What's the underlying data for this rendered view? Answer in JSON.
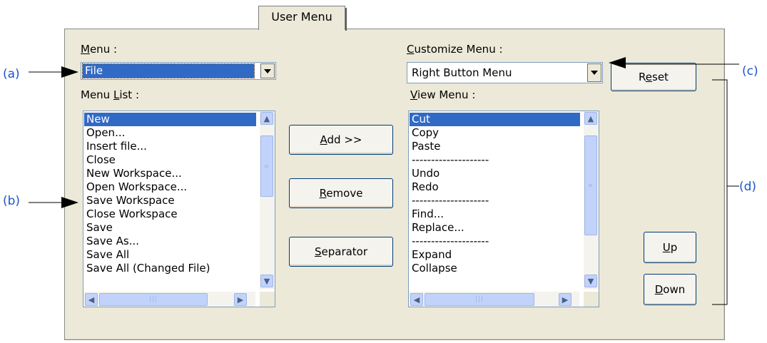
{
  "tab": {
    "label": "User Menu"
  },
  "menu": {
    "label_u": "M",
    "label_rest": "enu :",
    "value": "File"
  },
  "menu_list": {
    "label_pre": "Menu ",
    "label_u": "L",
    "label_post": "ist :",
    "items": [
      "New",
      "Open...",
      "Insert file...",
      "Close",
      "New Workspace...",
      "Open Workspace...",
      "Save Workspace",
      "Close Workspace",
      "Save",
      "Save As...",
      "Save All",
      "Save All (Changed File)"
    ],
    "selected_index": 0
  },
  "customize": {
    "label_u": "C",
    "label_rest": "ustomize Menu :",
    "value": "Right Button Menu"
  },
  "view_menu": {
    "label_u": "V",
    "label_rest": "iew Menu :",
    "items": [
      "Cut",
      "Copy",
      "Paste",
      "--------------------",
      "Undo",
      "Redo",
      "--------------------",
      "Find...",
      "Replace...",
      "--------------------",
      "Expand",
      "Collapse"
    ],
    "selected_index": 0
  },
  "buttons": {
    "add": {
      "u": "A",
      "rest": "dd >>"
    },
    "remove": {
      "u": "R",
      "rest": "emove"
    },
    "separator": {
      "u": "S",
      "rest": "eparator"
    },
    "reset": {
      "pre": "R",
      "u": "e",
      "rest": "set"
    },
    "up": {
      "u": "U",
      "rest": "p"
    },
    "down": {
      "u": "D",
      "rest": "own"
    }
  },
  "annotations": {
    "a": "(a)",
    "b": "(b)",
    "c": "(c)",
    "d": "(d)"
  },
  "colors": {
    "panel": "#ece9d8",
    "selection": "#316ac5",
    "annotation": "#1a56c9",
    "scroll": "#c1d3fb"
  },
  "icons": [
    "chevron-up-icon",
    "chevron-down-icon",
    "chevron-left-icon",
    "chevron-right-icon",
    "dropdown-arrow-icon"
  ]
}
